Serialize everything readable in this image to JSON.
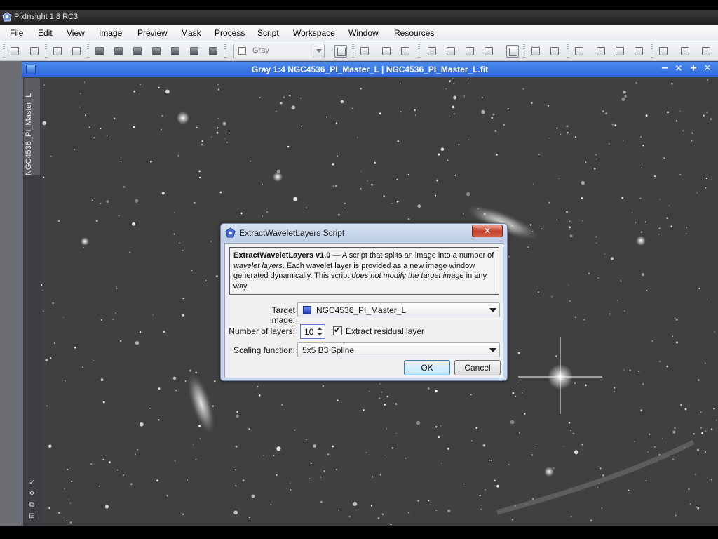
{
  "app": {
    "title": "PixInsight 1.8 RC3"
  },
  "menu": {
    "items": [
      "File",
      "Edit",
      "View",
      "Image",
      "Preview",
      "Mask",
      "Process",
      "Script",
      "Workspace",
      "Window",
      "Resources"
    ]
  },
  "toolbar": {
    "channel_combo": "Gray"
  },
  "image_window": {
    "title": "Gray 1:4 NGC4536_PI_Master_L | NGC4536_PI_Master_L.fit",
    "side_tab_label": "NGC4536_PI_Master_L",
    "controls": [
      "−",
      "⨯",
      "+",
      "✕"
    ]
  },
  "dialog": {
    "title": "ExtractWaveletLayers Script",
    "close_symbol": "✕",
    "info": {
      "name": "ExtractWaveletLayers v1.0",
      "text_1": " — A script that splits an image into a number of ",
      "em_1": "wavelet layers",
      "text_2": ". Each wavelet layer is provided as a new image window generated dynamically. This script ",
      "em_2": "does not modify the target image",
      "text_3": " in any way."
    },
    "target_image": {
      "label": "Target image:",
      "value": "NGC4536_PI_Master_L"
    },
    "num_layers": {
      "label": "Number of layers:",
      "value": "10"
    },
    "extract_residual": {
      "label": "Extract residual layer",
      "checked": true,
      "check_symbol": "✔"
    },
    "scaling_function": {
      "label": "Scaling function:",
      "value": "5x5 B3 Spline"
    },
    "ok_label": "OK",
    "cancel_label": "Cancel"
  },
  "colors": {
    "titlebar_blue": "#2e66d3",
    "dialog_frame": "#c9d7ea",
    "close_red": "#c2402a",
    "sky": "#404040"
  }
}
